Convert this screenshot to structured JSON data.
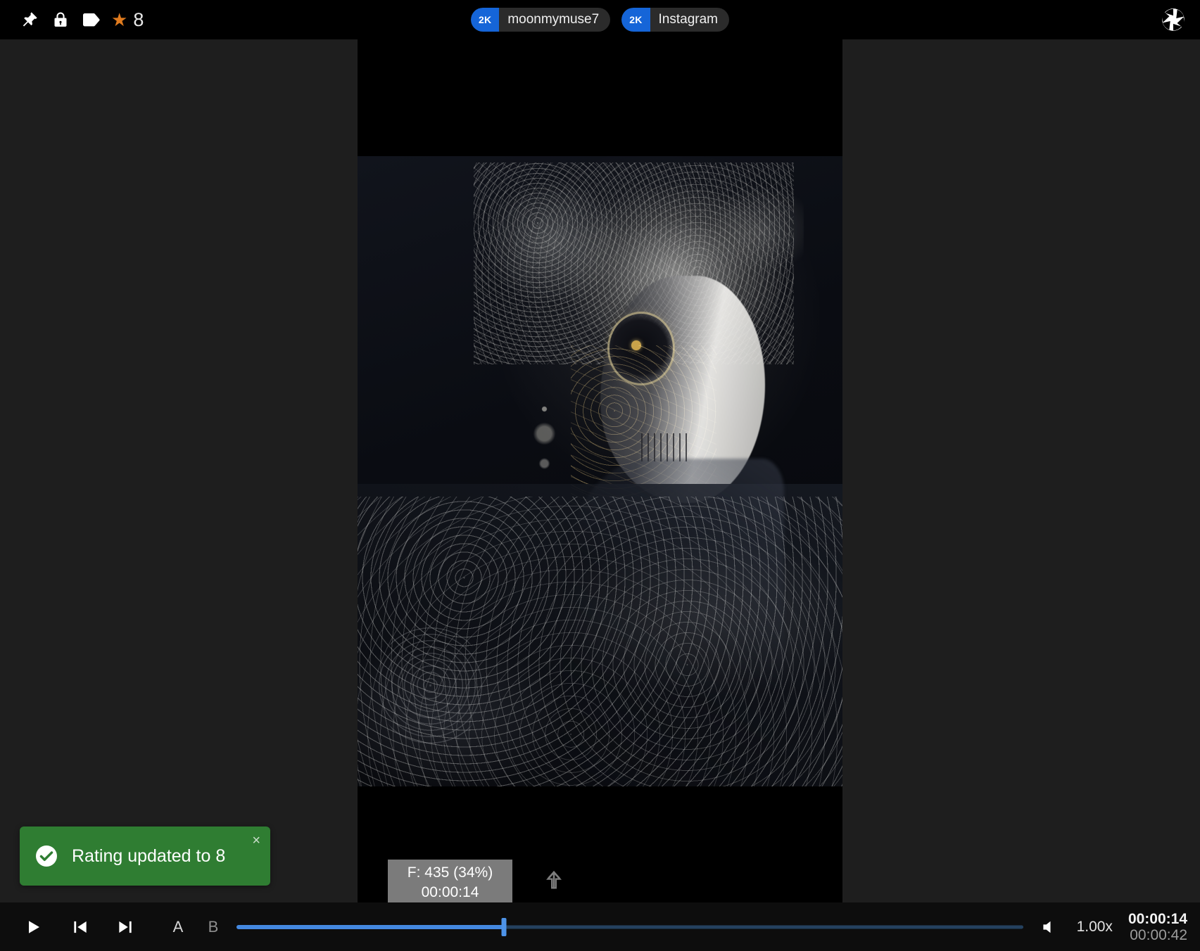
{
  "app": {
    "background_color": "#1e1e1e",
    "stage_color": "#000000",
    "accent_color": "#4488e0",
    "badge_color": "#1565d8",
    "star_color": "#e07b1e",
    "toast_color": "#2f7d32"
  },
  "topbar": {
    "icons": [
      {
        "name": "pin-icon",
        "label": "Pin"
      },
      {
        "name": "lock-icon",
        "label": "Lock"
      },
      {
        "name": "tag-icon",
        "label": "Tag"
      }
    ],
    "rating": {
      "star_glyph": "★",
      "value": "8"
    },
    "chips": [
      {
        "badge": "2K",
        "label": "moonmymuse7"
      },
      {
        "badge": "2K",
        "label": "Instagram"
      }
    ],
    "right_icon": {
      "name": "aperture-icon",
      "label": "Aperture"
    }
  },
  "toast": {
    "message": "Rating updated to 8",
    "close_glyph": "×",
    "icon": "check-circle-icon"
  },
  "frame_tooltip": {
    "frame_line": "F: 435 (34%)",
    "time_line": "00:00:14",
    "arrow_icon": "arrow-up-icon"
  },
  "controls": {
    "play_label": "Play",
    "prev_label": "Previous frame",
    "next_label": "Next frame",
    "marker_a": "A",
    "marker_b": "B",
    "progress_percent": 34,
    "volume_label": "Volume",
    "speed": "1.00x",
    "time_current": "00:00:14",
    "time_total": "00:00:42"
  }
}
